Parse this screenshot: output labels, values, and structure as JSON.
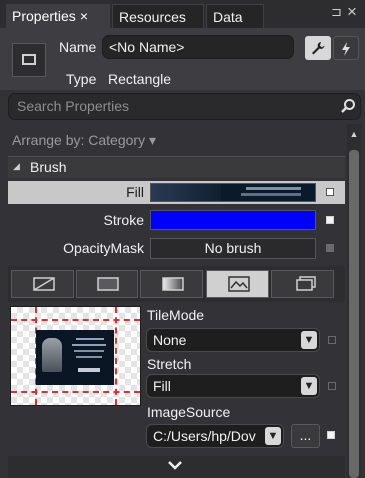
{
  "tabs": [
    {
      "label": "Properties",
      "close": "×"
    },
    {
      "label": "Resources"
    },
    {
      "label": "Data"
    }
  ],
  "window_controls": {
    "pin": "⊐",
    "close": "×"
  },
  "header": {
    "name_label": "Name",
    "name_value": "<No Name>",
    "type_label": "Type",
    "type_value": "Rectangle"
  },
  "search": {
    "placeholder": "Search Properties"
  },
  "arrange_by": "Arrange by: Category ▾",
  "brush": {
    "section_title": "Brush",
    "fill_label": "Fill",
    "stroke_label": "Stroke",
    "stroke_color": "#0000ff",
    "opacity_mask_label": "OpacityMask",
    "opacity_mask_value": "No brush"
  },
  "image_brush": {
    "tile_mode_label": "TileMode",
    "tile_mode_value": "None",
    "stretch_label": "Stretch",
    "stretch_value": "Fill",
    "image_source_label": "ImageSource",
    "image_source_value": "C:/Users/hp/Dov",
    "browse_label": "..."
  },
  "colors": {
    "selected_row": "#c8c8c8",
    "accent": "#0000ff"
  },
  "expand_icon": "chevron-down-icon"
}
